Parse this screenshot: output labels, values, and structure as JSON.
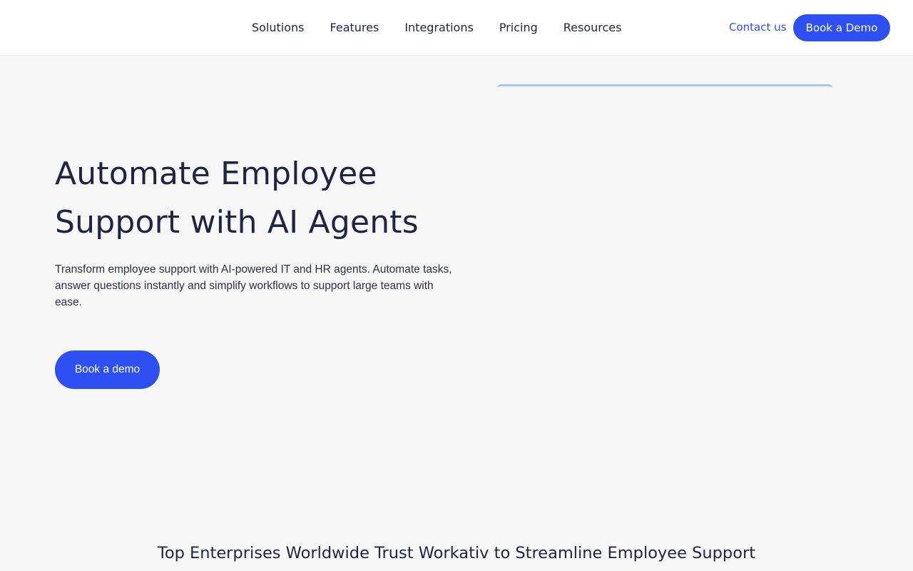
{
  "header": {
    "nav": [
      "Solutions",
      "Features",
      "Integrations",
      "Pricing",
      "Resources"
    ],
    "contact_label": "Contact us",
    "demo_label": "Book a Demo"
  },
  "hero": {
    "title_line1": "Automate Employee",
    "title_line2": "Support with AI Agents",
    "description": "Transform employee support with AI-powered IT and HR agents. Automate tasks, answer questions instantly and simplify workflows to support large teams with ease.",
    "cta_label": "Book a demo"
  },
  "trust": {
    "heading": "Top Enterprises Worldwide Trust Workativ to Streamline Employee Support"
  },
  "colors": {
    "accent": "#2e4ff2",
    "text": "#1e2444",
    "background": "#f7f7f7"
  }
}
